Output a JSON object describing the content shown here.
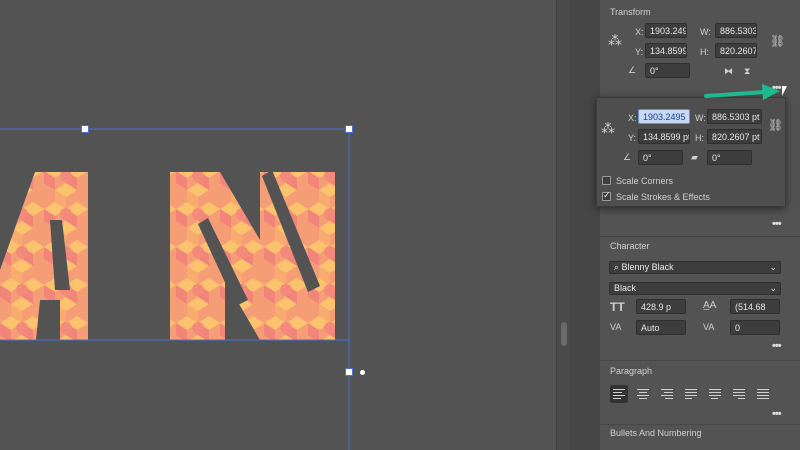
{
  "transform": {
    "title": "Transform",
    "x_label": "X:",
    "x_value": "1903.249",
    "y_label": "Y:",
    "y_value": "134.8599",
    "w_label": "W:",
    "w_value": "886.5303",
    "h_label": "H:",
    "h_value": "820.2607",
    "angle_value": "0°"
  },
  "popup": {
    "x_label": "X:",
    "x_value": "1903.2495",
    "y_label": "Y:",
    "y_value": "134.8599 pt",
    "w_label": "W:",
    "w_value": "886.5303 pt",
    "h_label": "H:",
    "h_value": "820.2607 pt",
    "angle_value": "0°",
    "shear_value": "0°",
    "scale_corners_label": "Scale Corners",
    "scale_strokes_label": "Scale Strokes & Effects",
    "scale_corners_checked": false,
    "scale_strokes_checked": true
  },
  "character": {
    "title": "Character",
    "font_family": "Blenny Black",
    "font_style": "Black",
    "font_size": "428.9 p",
    "leading": "(514.68",
    "kerning": "Auto",
    "tracking": "0"
  },
  "paragraph": {
    "title": "Paragraph"
  },
  "bullets": {
    "title": "Bullets And Numbering"
  },
  "more_label": "•••",
  "colors": {
    "arrow": "#1fb98f",
    "selection": "#4a6fd6",
    "text_fill_a": "#f08a7a",
    "text_fill_b": "#f7bf6c"
  }
}
